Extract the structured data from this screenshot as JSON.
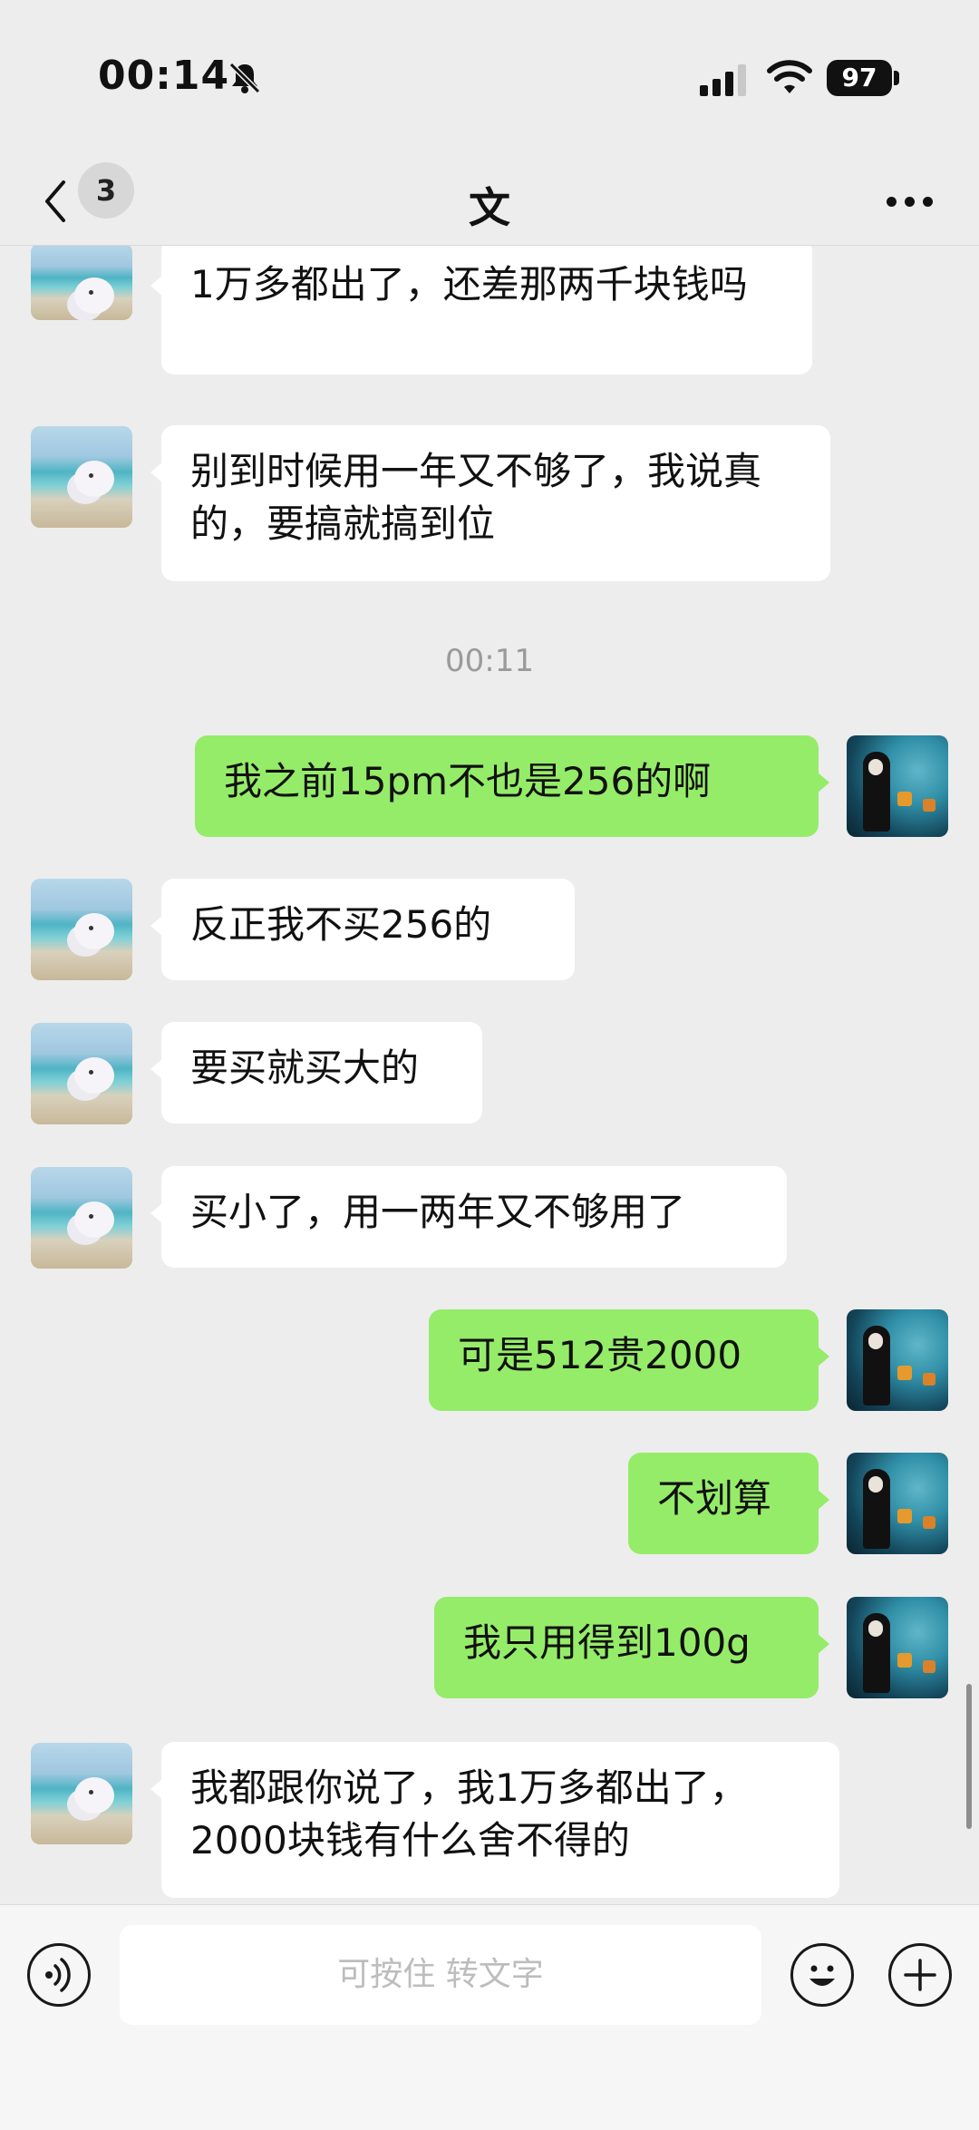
{
  "status_bar": {
    "time": "00:14",
    "battery": "97"
  },
  "nav": {
    "unread_count": "3",
    "title": "文"
  },
  "messages": [
    {
      "side": "in",
      "text": "1万多都出了，还差那两千块钱吗"
    },
    {
      "side": "in",
      "text": "别到时候用一年又不够了，我说真的，要搞就搞到位"
    },
    {
      "timestamp": "00:11"
    },
    {
      "side": "out",
      "text": "我之前15pm不也是256的啊"
    },
    {
      "side": "in",
      "text": "反正我不买256的"
    },
    {
      "side": "in",
      "text": "要买就买大的"
    },
    {
      "side": "in",
      "text": "买小了，用一两年又不够用了"
    },
    {
      "side": "out",
      "text": "可是512贵2000"
    },
    {
      "side": "out",
      "text": "不划算"
    },
    {
      "side": "out",
      "text": "我只用得到100g"
    },
    {
      "side": "in",
      "text": "我都跟你说了，我1万多都出了，2000块钱有什么舍不得的"
    }
  ],
  "input": {
    "placeholder": "可按住 转文字"
  },
  "icons": {
    "mute": "bell-slash-icon",
    "signal": "cellular-signal-icon",
    "wifi": "wifi-icon",
    "back": "chevron-left-icon",
    "more": "more-dots-icon",
    "voice": "voice-icon",
    "emoji": "emoji-icon",
    "plus": "plus-icon"
  },
  "colors": {
    "background": "#ededed",
    "outgoing_bubble": "#95ec69",
    "incoming_bubble": "#ffffff"
  }
}
